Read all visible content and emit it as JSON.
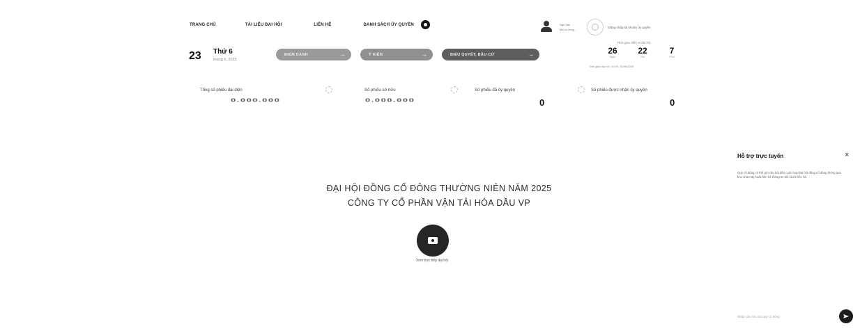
{
  "nav": {
    "home": "TRANG CHỦ",
    "docs": "TÀI LIỆU ĐẠI HỘI",
    "contact": "LIÊN HỆ",
    "proxy_list": "DANH SÁCH ỦY QUYỀN"
  },
  "user": {
    "line1": "Ngo Van ...",
    "line2": "Ma co dong ...",
    "link": "Đăng nhập tài khoản ủy quyền"
  },
  "date": {
    "day": "23",
    "weekday": "Thứ 6",
    "month": "tháng 5, 2025"
  },
  "actions": [
    {
      "label": "ĐIỂM DANH",
      "arrow": "→"
    },
    {
      "label": "Ý KIẾN",
      "arrow": "→"
    },
    {
      "label": "BIỂU QUYẾT, BẦU CỬ",
      "arrow": "→"
    }
  ],
  "countdown": {
    "title": "Thời gian diễn ra đại hội",
    "items": [
      {
        "value": "26",
        "unit": "Ngày"
      },
      {
        "value": "22",
        "unit": "Giờ"
      },
      {
        "value": "7",
        "unit": "Phút"
      }
    ],
    "note": "Thời gian đại hội: 10:00, 20/06/2025"
  },
  "stats": [
    {
      "label": "Tổng số phiếu đại diện",
      "value": "0.000.000"
    },
    {
      "label": "Số phiếu sở hữu",
      "value": "0.000.000"
    },
    {
      "label": "Số phiếu đã ủy quyền",
      "value": "0"
    },
    {
      "label": "Số phiếu được nhận ủy quyền",
      "value": "0"
    }
  ],
  "heading": {
    "line1": "ĐẠI HỘI ĐỒNG CỔ ĐÔNG THƯỜNG NIÊN NĂM 2025",
    "line2": "CÔNG TY CỔ PHẦN VẬN TẢI HÓA DẦU VP"
  },
  "live": {
    "caption": "Xem trực tiếp đại hội"
  },
  "support": {
    "title": "Hỗ trợ trực tuyến",
    "close": "×",
    "message": "Quý cổ đông có thể gửi câu hỏi đến cuộc họp Đại hội đồng cổ đông thông qua box chat này hoặc liên hệ thông tin bên dưới liên hệ.",
    "placeholder": "Nhập câu hỏi của quý cổ đông"
  },
  "icons": {
    "nav_dot": "record-icon",
    "user": "user-icon",
    "avatar": "avatar-icon",
    "stat": "stat-icon",
    "live": "camera-icon",
    "send": "send-icon"
  }
}
